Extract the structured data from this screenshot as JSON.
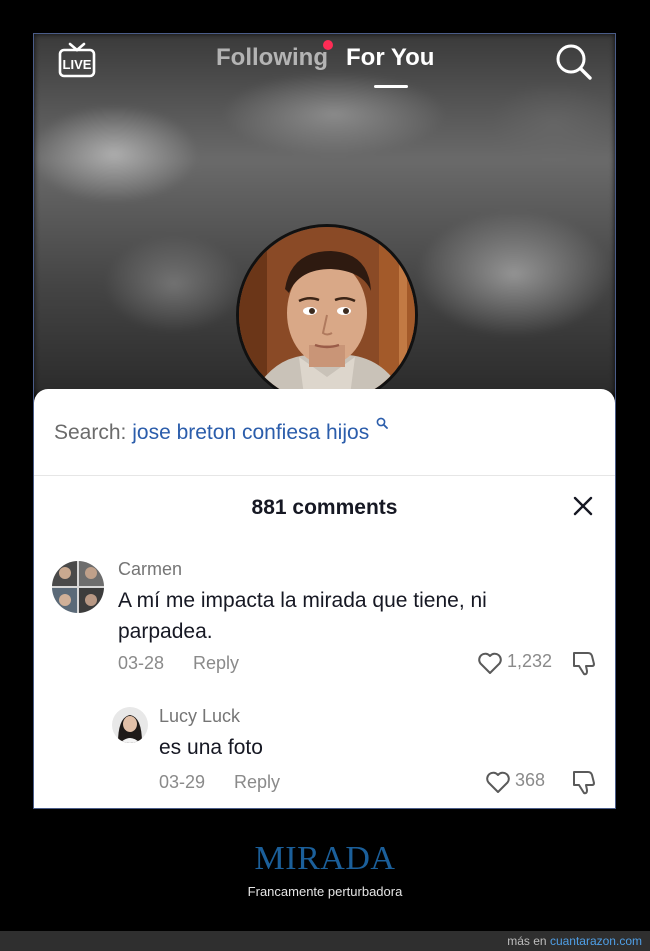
{
  "topbar": {
    "live_label": "LIVE",
    "tab_following": "Following",
    "tab_for_you": "For You"
  },
  "search": {
    "label": "Search:",
    "query": "jose breton confiesa hijos"
  },
  "comments_header": {
    "count_label": "881 comments"
  },
  "comments": [
    {
      "name": "Carmen",
      "text": "A mí me impacta la mirada que tiene, ni parpadea.",
      "date": "03-28",
      "reply_label": "Reply",
      "likes": "1,232"
    },
    {
      "name": "Lucy Luck",
      "text": "es una foto",
      "date": "03-29",
      "reply_label": "Reply",
      "likes": "368"
    }
  ],
  "caption": {
    "title": "MIRADA",
    "subtitle": "Francamente perturbadora"
  },
  "footer": {
    "prefix": "más en",
    "link": "cuantarazon.com"
  },
  "colors": {
    "accent_blue": "#2b5dab",
    "live_dot": "#fe2c55",
    "caption_title": "#1b5f9a"
  }
}
